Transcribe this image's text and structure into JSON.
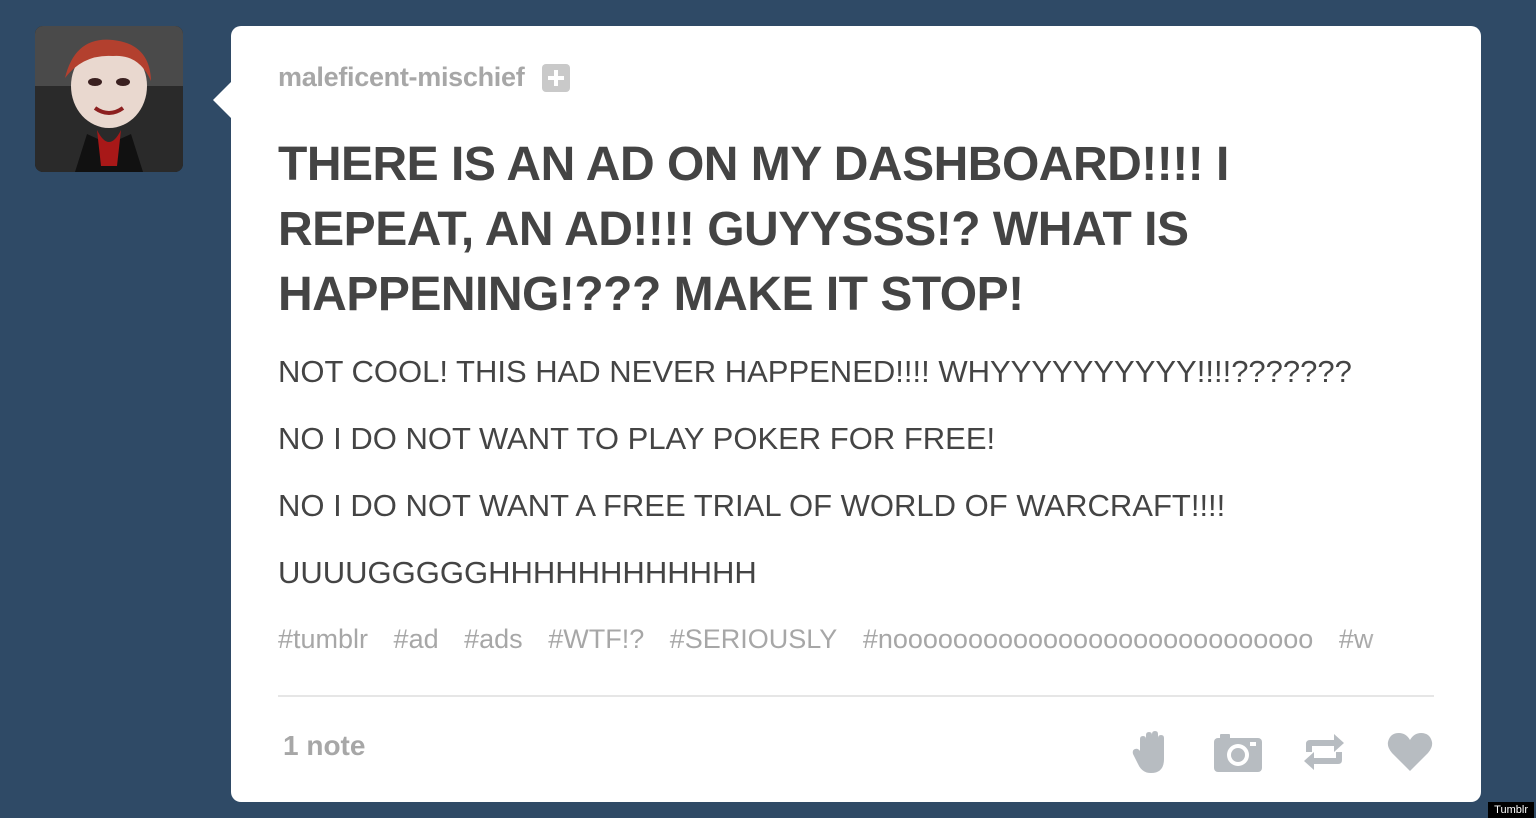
{
  "post": {
    "username": "maleficent-mischief",
    "title": "THERE IS AN AD ON MY DASHBOARD!!!! I REPEAT, AN AD!!!! GUYYSSS!? WHAT IS HAPPENING!??? MAKE IT STOP!",
    "body": [
      "NOT COOL! THIS HAD NEVER HAPPENED!!!! WHYYYYYYYYYY!!!!???????",
      "NO I DO NOT WANT TO PLAY POKER FOR FREE!",
      "NO I DO NOT WANT A FREE TRIAL OF WORLD OF WARCRAFT!!!!",
      "UUUUGGGGGHHHHHHHHHHHH"
    ],
    "tags": [
      "#tumblr",
      "#ad",
      "#ads",
      "#WTF!?",
      "#SERIOUSLY",
      "#noooooooooooooooooooooooooooo",
      "#w"
    ],
    "notes": "1 note"
  },
  "icons": {
    "follow": "plus-icon",
    "wave": "hand-icon",
    "photo": "camera-icon",
    "reblog": "reblog-icon",
    "like": "heart-icon"
  },
  "colors": {
    "background": "#2f4a66",
    "card": "#ffffff",
    "text": "#444444",
    "muted": "#a7a7a7",
    "icon": "#b7bcc1"
  },
  "watermark": "Tumblr"
}
